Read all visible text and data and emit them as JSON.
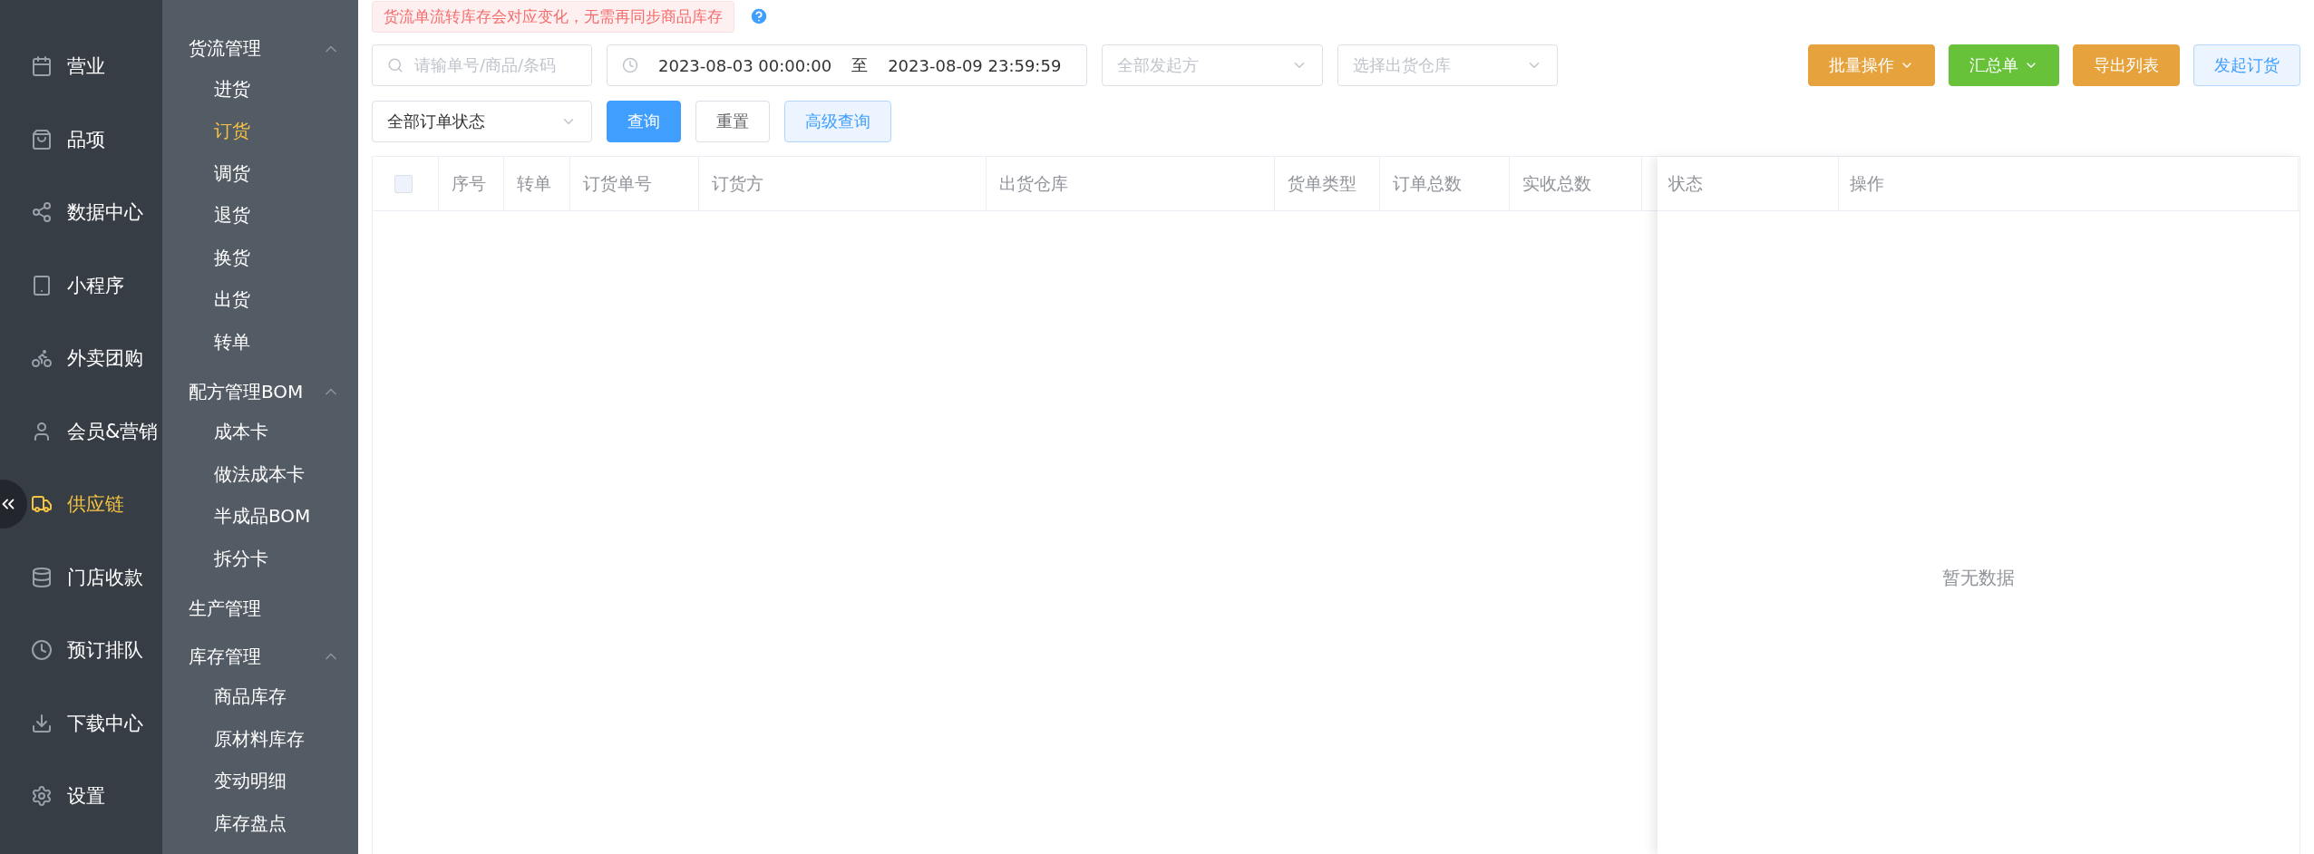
{
  "nav": {
    "items": [
      {
        "label": "营业",
        "selected": false
      },
      {
        "label": "品项",
        "selected": false
      },
      {
        "label": "数据中心",
        "selected": false
      },
      {
        "label": "小程序",
        "selected": false
      },
      {
        "label": "外卖团购",
        "selected": false
      },
      {
        "label": "会员&营销",
        "selected": false
      },
      {
        "label": "供应链",
        "selected": true
      },
      {
        "label": "门店收款",
        "selected": false
      },
      {
        "label": "预订排队",
        "selected": false
      },
      {
        "label": "下载中心",
        "selected": false
      },
      {
        "label": "设置",
        "selected": false
      }
    ]
  },
  "submenu": [
    {
      "label": "货流管理",
      "expanded": true,
      "children": [
        {
          "label": "进货",
          "selected": false
        },
        {
          "label": "订货",
          "selected": true
        },
        {
          "label": "调货",
          "selected": false
        },
        {
          "label": "退货",
          "selected": false
        },
        {
          "label": "换货",
          "selected": false
        },
        {
          "label": "出货",
          "selected": false
        },
        {
          "label": "转单",
          "selected": false
        }
      ]
    },
    {
      "label": "配方管理BOM",
      "expanded": true,
      "children": [
        {
          "label": "成本卡",
          "selected": false
        },
        {
          "label": "做法成本卡",
          "selected": false
        },
        {
          "label": "半成品BOM",
          "selected": false
        },
        {
          "label": "拆分卡",
          "selected": false
        }
      ]
    },
    {
      "label": "生产管理"
    },
    {
      "label": "库存管理",
      "expanded": true,
      "children": [
        {
          "label": "商品库存",
          "selected": false
        },
        {
          "label": "原材料库存",
          "selected": false
        },
        {
          "label": "变动明细",
          "selected": false
        },
        {
          "label": "库存盘点",
          "selected": false
        }
      ]
    }
  ],
  "notice": "货流单流转库存会对应变化，无需再同步商品库存",
  "filters": {
    "search": {
      "placeholder": "请输单号/商品/条码"
    },
    "date_start": "2023-08-03 00:00:00",
    "date_separator": "至",
    "date_end": "2023-08-09 23:59:59",
    "initiator": {
      "placeholder": "全部发起方"
    },
    "warehouse": {
      "placeholder": "选择出货仓库"
    },
    "status": {
      "value": "全部订单状态"
    }
  },
  "actions": [
    {
      "label": "批量操作",
      "kind": "dropdown",
      "color": "#e6a23c"
    },
    {
      "label": "汇总单",
      "kind": "dropdown",
      "color": "#67c23a"
    },
    {
      "label": "导出列表",
      "kind": "solid",
      "color": "#e6a23c"
    },
    {
      "label": "发起订货",
      "kind": "light",
      "color": "#409eff"
    }
  ],
  "query_buttons": [
    {
      "label": "查询",
      "kind": "primary"
    },
    {
      "label": "重置",
      "kind": "plain"
    },
    {
      "label": "高级查询",
      "kind": "light"
    }
  ],
  "table": {
    "select_all_checked": false,
    "columns": [
      "序号",
      "转单",
      "订货单号",
      "订货方",
      "出货仓库",
      "货单类型",
      "订单总数",
      "实收总数"
    ],
    "fixed_columns": [
      "状态",
      "操作"
    ],
    "empty_text": "暂无数据"
  }
}
